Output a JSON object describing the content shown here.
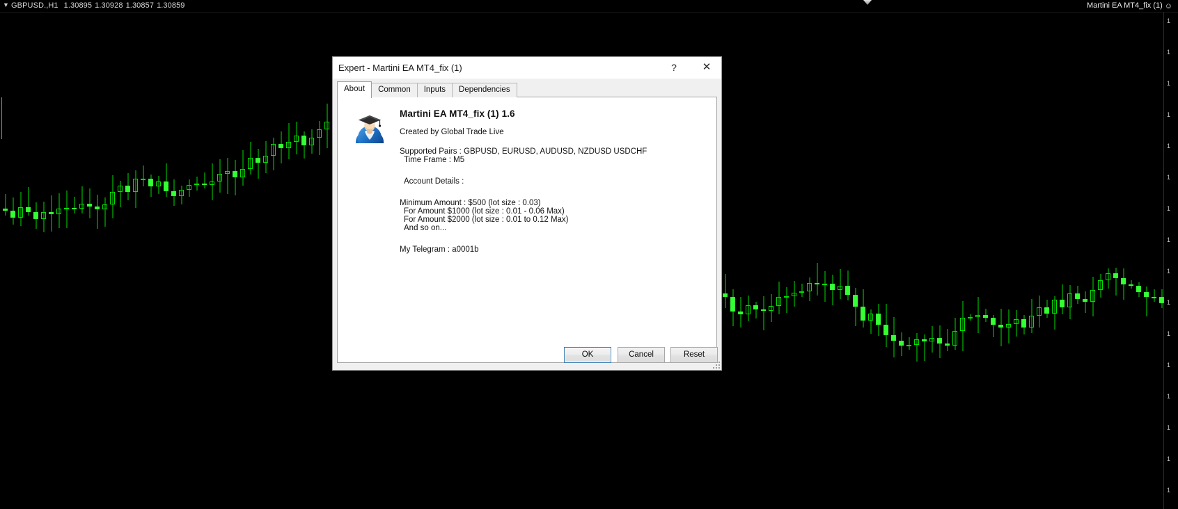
{
  "chart": {
    "symbol_line": {
      "dropdown_icon": "caret-down-icon",
      "symbol": "GBPUSD.,H1",
      "open": "1.30895",
      "high": "1.30928",
      "low": "1.30857",
      "close": "1.30859"
    },
    "ea_label": "Martini EA MT4_fix (1)",
    "ea_status_icon": "smiley-face-icon",
    "background_color": "#000000",
    "candle_color": "#00e000",
    "price_scale_labels": [
      "1",
      "1",
      "1",
      "1",
      "1",
      "1",
      "1",
      "1",
      "1",
      "1",
      "1",
      "1",
      "1",
      "1",
      "1",
      "1"
    ]
  },
  "dialog": {
    "title": "Expert - Martini EA MT4_fix (1)",
    "help_button_label": "?",
    "close_button_label": "✕",
    "tabs": [
      {
        "label": "About",
        "active": true
      },
      {
        "label": "Common",
        "active": false
      },
      {
        "label": "Inputs",
        "active": false
      },
      {
        "label": "Dependencies",
        "active": false
      }
    ],
    "about": {
      "icon": "graduate-avatar-icon",
      "title": "Martini EA MT4_fix (1) 1.6",
      "creator": "Created by Global Trade Live",
      "lines": [
        "Supported Pairs : GBPUSD, EURUSD, AUDUSD, NZDUSD  USDCHF",
        "Time Frame : M5",
        "Account Details :",
        "Minimum Amount : $500 (lot size : 0.03)",
        "For Amount $1000 (lot size : 0.01 - 0.06 Max)",
        "For Amount $2000 (lot size : 0.01 to 0.12 Max)",
        "And so on...",
        "My Telegram : a0001b"
      ]
    },
    "buttons": {
      "ok": "OK",
      "cancel": "Cancel",
      "reset": "Reset"
    }
  }
}
